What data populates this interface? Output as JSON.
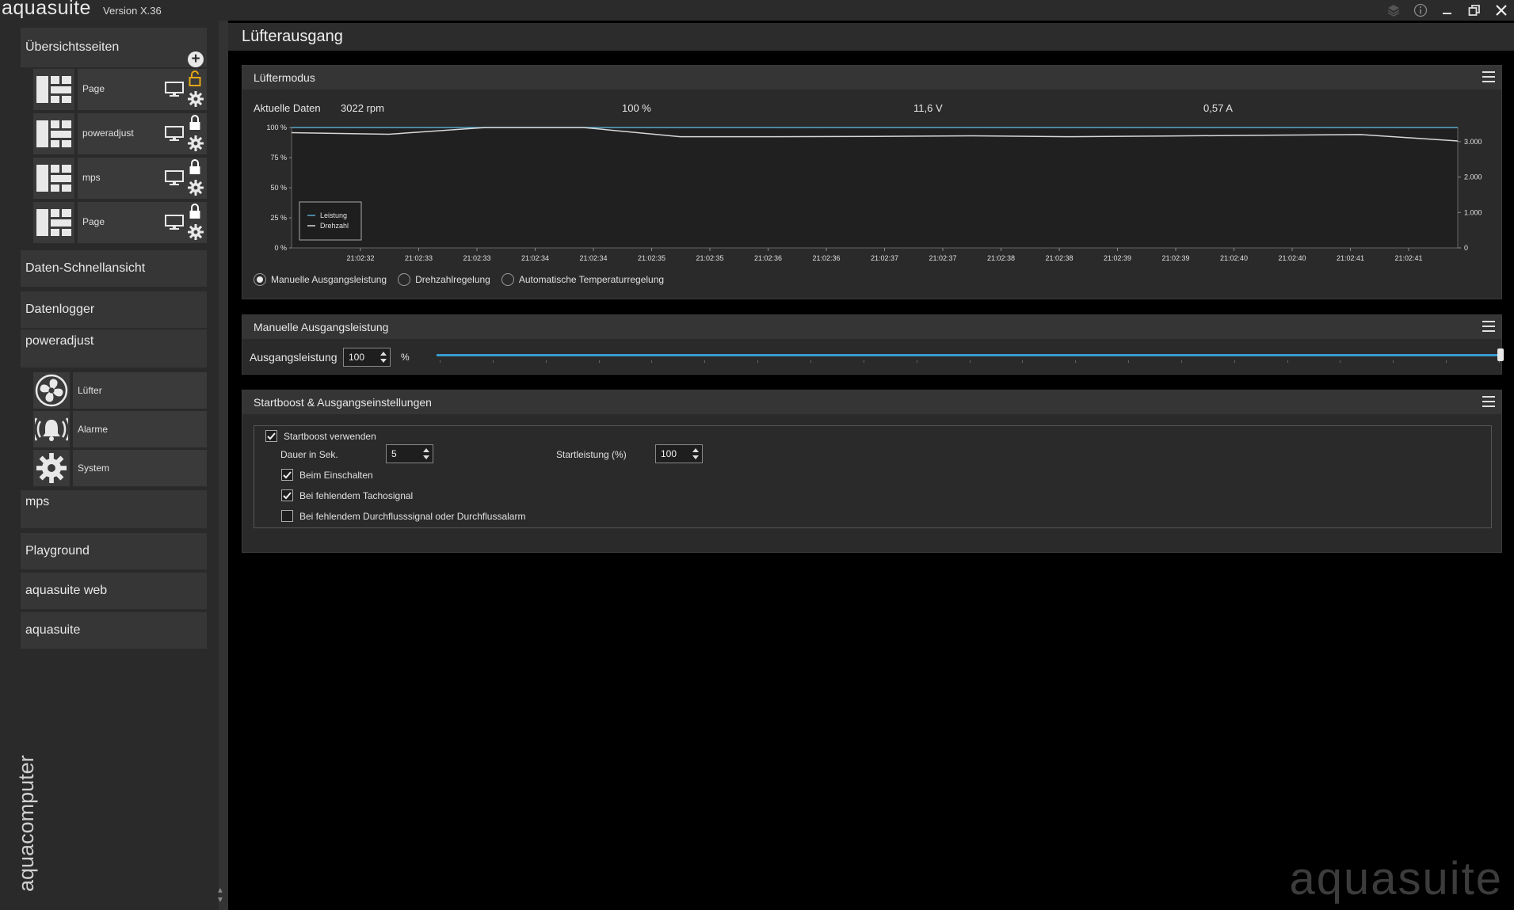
{
  "app": {
    "name": "aquasuite",
    "version": "Version X.36",
    "window_buttons": [
      "layers-icon",
      "info-icon",
      "minimize-icon",
      "restore-icon",
      "close-icon"
    ]
  },
  "sidebar": {
    "overview_label": "Übersichtsseiten",
    "pages": [
      {
        "label": "Page",
        "lock_color": "#e6a817"
      },
      {
        "label": "poweradjust",
        "lock_color": "#ffffff"
      },
      {
        "label": "mps",
        "lock_color": "#ffffff"
      },
      {
        "label": "Page",
        "lock_color": "#ffffff"
      }
    ],
    "quickview_label": "Daten-Schnellansicht",
    "datalogger_label": "Datenlogger",
    "device_label": "poweradjust",
    "device_items": [
      {
        "label": "Lüfter",
        "icon": "fan-icon"
      },
      {
        "label": "Alarme",
        "icon": "alarm-bell-icon"
      },
      {
        "label": "System",
        "icon": "gear-icon"
      }
    ],
    "mps_label": "mps",
    "playground_label": "Playground",
    "web_label": "aquasuite web",
    "aquasuite_label": "aquasuite",
    "brand_vertical": "aquacomputer"
  },
  "main": {
    "title": "Lüfterausgang",
    "watermark": "aquasuite"
  },
  "fan_mode_panel": {
    "title": "Lüftermodus",
    "current_label": "Aktuelle Daten",
    "rpm": "3022 rpm",
    "percent": "100 %",
    "voltage": "11,6 V",
    "current": "0,57 A",
    "modes": [
      {
        "label": "Manuelle Ausgangsleistung",
        "selected": true
      },
      {
        "label": "Drehzahlregelung",
        "selected": false
      },
      {
        "label": "Automatische Temperaturregelung",
        "selected": false
      }
    ]
  },
  "chart_data": {
    "type": "line",
    "x": [
      "21:02:32",
      "21:02:33",
      "21:02:33",
      "21:02:34",
      "21:02:34",
      "21:02:35",
      "21:02:35",
      "21:02:36",
      "21:02:36",
      "21:02:37",
      "21:02:37",
      "21:02:38",
      "21:02:38",
      "21:02:39",
      "21:02:39",
      "21:02:40",
      "21:02:40",
      "21:02:41",
      "21:02:41"
    ],
    "y_left_ticks": [
      "100 %",
      "75 %",
      "50 %",
      "25 %",
      "0 %"
    ],
    "y_left_range": [
      0,
      100
    ],
    "y_right_ticks": [
      "3.000",
      "2.000",
      "1.000",
      "0"
    ],
    "y_right_range": [
      0,
      3400
    ],
    "series": [
      {
        "name": "Leistung",
        "axis": "left",
        "color": "#5aa9c9",
        "values": [
          100,
          100,
          100,
          100,
          100,
          100,
          100,
          100,
          100,
          100,
          100,
          100,
          100,
          100,
          100,
          100,
          100,
          100,
          100,
          100,
          100
        ]
      },
      {
        "name": "Drehzahl",
        "axis": "right",
        "color": "#d8d8d8",
        "values": [
          3255,
          3210,
          3400,
          3400,
          3140,
          3140,
          3150,
          3165,
          3140,
          3160,
          3180,
          3200,
          3020
        ]
      }
    ],
    "legend": "bottom-left",
    "grid": false
  },
  "manual_panel": {
    "title": "Manuelle Ausgangsleistung",
    "label": "Ausgangsleistung",
    "value": "100",
    "unit": "%",
    "slider_level": 1.0
  },
  "startboost_panel": {
    "title": "Startboost & Ausgangseinstellungen",
    "use_label": "Startboost verwenden",
    "use_checked": true,
    "duration_label": "Dauer in Sek.",
    "duration_value": "5",
    "start_power_label": "Startleistung (%)",
    "start_power_value": "100",
    "options": [
      {
        "label": "Beim Einschalten",
        "checked": true
      },
      {
        "label": "Bei fehlendem Tachosignal",
        "checked": true
      },
      {
        "label": "Bei fehlendem Durchflusssignal oder Durchflussalarm",
        "checked": false
      }
    ]
  }
}
